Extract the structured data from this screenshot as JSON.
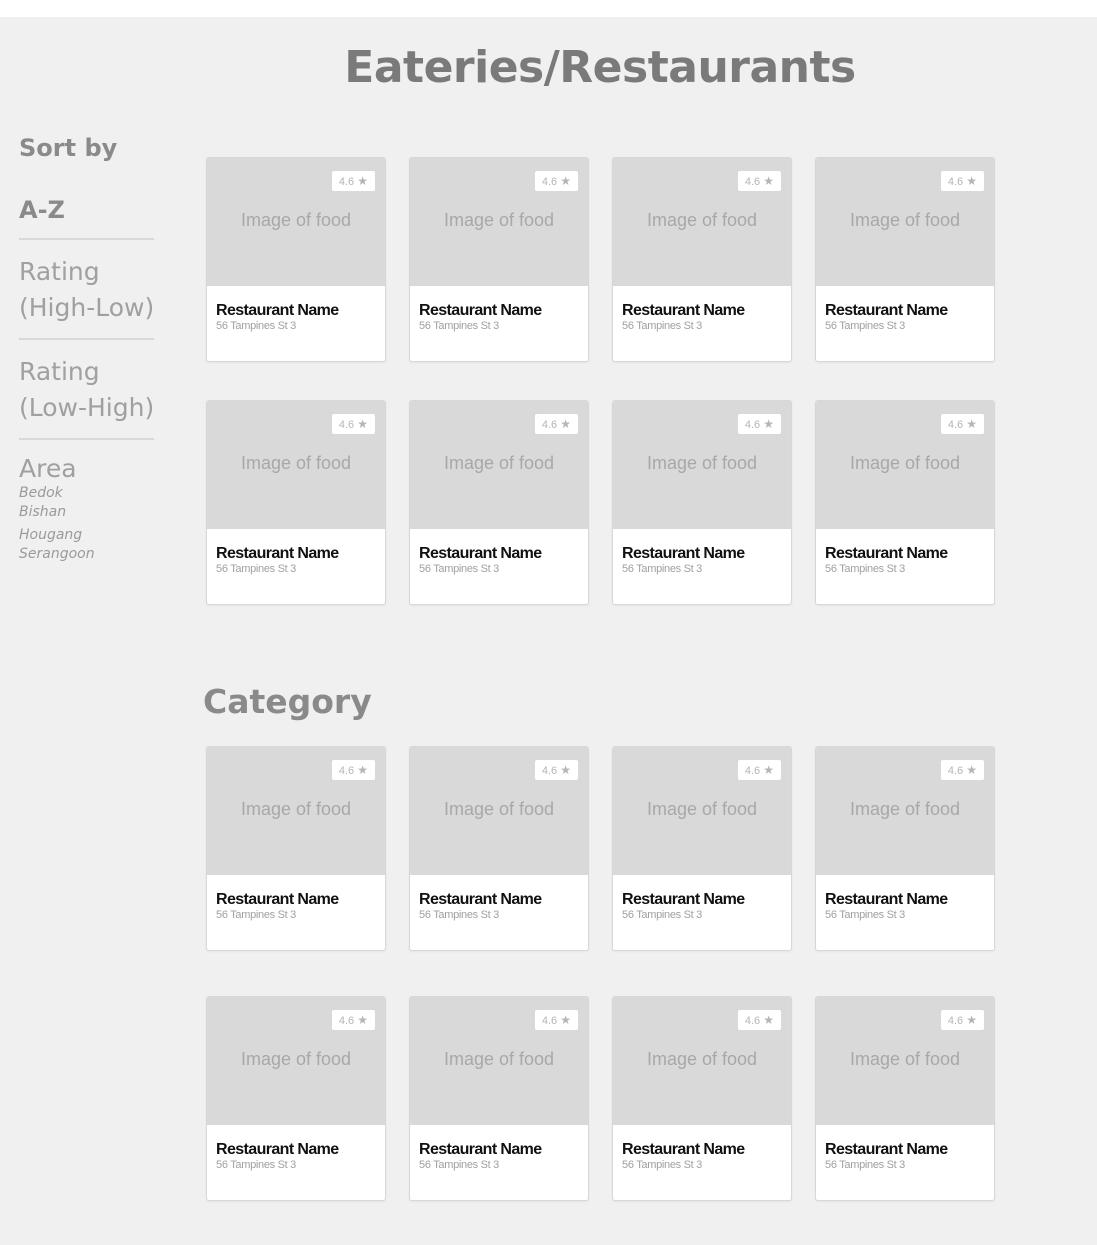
{
  "page": {
    "title": "Eateries/Restaurants",
    "category_title": "Category"
  },
  "sidebar": {
    "sort_by": "Sort by",
    "options": [
      {
        "label": "A-Z"
      },
      {
        "label": "Rating\n(High-Low)"
      },
      {
        "label": "Rating\n(Low-High)"
      }
    ],
    "area_label": "Area",
    "areas": [
      "Bedok",
      "Bishan",
      "Hougang",
      "Serangoon"
    ]
  },
  "sections": [
    {
      "cards": [
        {
          "rating": "4.6",
          "image_placeholder": "Image of food",
          "name": "Restaurant Name",
          "address": "56 Tampines St 3"
        },
        {
          "rating": "4.6",
          "image_placeholder": "Image of food",
          "name": "Restaurant Name",
          "address": "56 Tampines St 3"
        },
        {
          "rating": "4.6",
          "image_placeholder": "Image of food",
          "name": "Restaurant Name",
          "address": "56 Tampines St 3"
        },
        {
          "rating": "4.6",
          "image_placeholder": "Image of food",
          "name": "Restaurant Name",
          "address": "56 Tampines St 3"
        },
        {
          "rating": "4.6",
          "image_placeholder": "Image of food",
          "name": "Restaurant Name",
          "address": "56 Tampines St 3"
        },
        {
          "rating": "4.6",
          "image_placeholder": "Image of food",
          "name": "Restaurant Name",
          "address": "56 Tampines St 3"
        },
        {
          "rating": "4.6",
          "image_placeholder": "Image of food",
          "name": "Restaurant Name",
          "address": "56 Tampines St 3"
        },
        {
          "rating": "4.6",
          "image_placeholder": "Image of food",
          "name": "Restaurant Name",
          "address": "56 Tampines St 3"
        }
      ]
    },
    {
      "cards": [
        {
          "rating": "4.6",
          "image_placeholder": "Image of food",
          "name": "Restaurant Name",
          "address": "56 Tampines St 3"
        },
        {
          "rating": "4.6",
          "image_placeholder": "Image of food",
          "name": "Restaurant Name",
          "address": "56 Tampines St 3"
        },
        {
          "rating": "4.6",
          "image_placeholder": "Image of food",
          "name": "Restaurant Name",
          "address": "56 Tampines St 3"
        },
        {
          "rating": "4.6",
          "image_placeholder": "Image of food",
          "name": "Restaurant Name",
          "address": "56 Tampines St 3"
        },
        {
          "rating": "4.6",
          "image_placeholder": "Image of food",
          "name": "Restaurant Name",
          "address": "56 Tampines St 3"
        },
        {
          "rating": "4.6",
          "image_placeholder": "Image of food",
          "name": "Restaurant Name",
          "address": "56 Tampines St 3"
        },
        {
          "rating": "4.6",
          "image_placeholder": "Image of food",
          "name": "Restaurant Name",
          "address": "56 Tampines St 3"
        },
        {
          "rating": "4.6",
          "image_placeholder": "Image of food",
          "name": "Restaurant Name",
          "address": "56 Tampines St 3"
        }
      ]
    }
  ],
  "icons": {
    "rating": "star-icon",
    "rating_glyph": "★"
  },
  "colors": {
    "background": "#f0f0f0",
    "image_placeholder": "#d9d9d9",
    "heading": "#7a7a7a"
  }
}
